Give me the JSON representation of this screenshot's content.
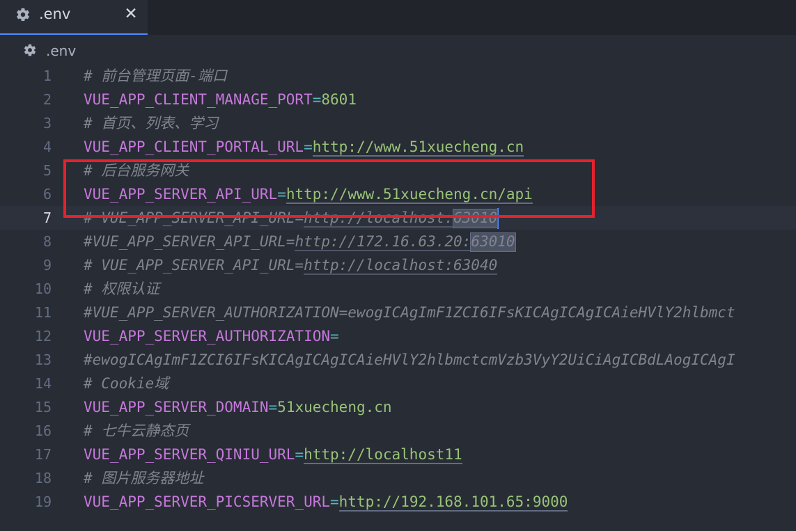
{
  "tab": {
    "title": ".env",
    "close": "✕",
    "icon": "gear-icon"
  },
  "breadcrumb": {
    "title": ".env",
    "icon": "gear-icon"
  },
  "colors": {
    "background": "#282c34",
    "key": "#c678dd",
    "value": "#98c379",
    "comment": "#7f848e",
    "highlight_box": "#e5222c",
    "cursor": "#528bff"
  },
  "editor": {
    "current_line": 7,
    "lines": [
      {
        "n": "1",
        "comment": "# 前台管理页面-端口"
      },
      {
        "n": "2",
        "key": "VUE_APP_CLIENT_MANAGE_PORT",
        "eq": "=",
        "value": "8601"
      },
      {
        "n": "3",
        "comment": "# 首页、列表、学习"
      },
      {
        "n": "4",
        "key": "VUE_APP_CLIENT_PORTAL_URL",
        "eq": "=",
        "value": "http://www.51xuecheng.cn"
      },
      {
        "n": "5",
        "comment": "# 后台服务网关"
      },
      {
        "n": "6",
        "key": "VUE_APP_SERVER_API_URL",
        "eq": "=",
        "value": "http://www.51xuecheng.cn/api"
      },
      {
        "n": "7",
        "comment_prefix": "# VUE_APP_SERVER_API_URL=",
        "comment_url": "http://localhost:",
        "comment_port": "63010"
      },
      {
        "n": "8",
        "comment_prefix": "#VUE_APP_SERVER_API_URL=",
        "comment_url": "http://172.16.63.20:",
        "comment_port": "63010"
      },
      {
        "n": "9",
        "comment_prefix": "# VUE_APP_SERVER_API_URL=",
        "comment_url": "http://localhost:63040"
      },
      {
        "n": "10",
        "comment": "# 权限认证"
      },
      {
        "n": "11",
        "comment": "#VUE_APP_SERVER_AUTHORIZATION=ewogICAgImF1ZCI6IFsKICAgICAgICAieHVlY2hlbmct"
      },
      {
        "n": "12",
        "key": "VUE_APP_SERVER_AUTHORIZATION",
        "eq": "="
      },
      {
        "n": "13",
        "comment": "#ewogICAgImF1ZCI6IFsKICAgICAgICAieHVlY2hlbmctcmVzb3VyY2UiCiAgICBdLAogICAgI"
      },
      {
        "n": "14",
        "comment": "# Cookie域"
      },
      {
        "n": "15",
        "key": "VUE_APP_SERVER_DOMAIN",
        "eq": "=",
        "value": "51xuecheng.cn"
      },
      {
        "n": "16",
        "comment": "# 七牛云静态页"
      },
      {
        "n": "17",
        "key": "VUE_APP_SERVER_QINIU_URL",
        "eq": "=",
        "value": "http://localhost11"
      },
      {
        "n": "18",
        "comment": "# 图片服务器地址"
      },
      {
        "n": "19",
        "key": "VUE_APP_SERVER_PICSERVER_URL",
        "eq": "=",
        "value": "http://192.168.101.65:9000"
      }
    ]
  }
}
